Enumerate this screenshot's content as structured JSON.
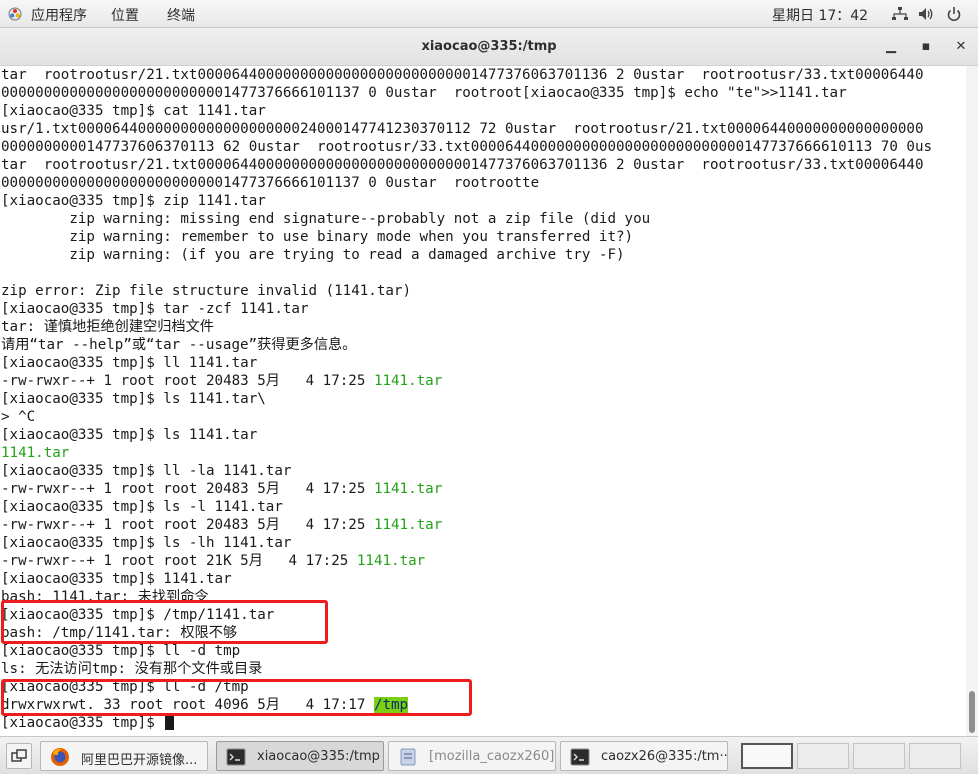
{
  "topbar": {
    "apps_label": "应用程序",
    "places_label": "位置",
    "terminal_label": "终端",
    "clock": "星期日 17：42"
  },
  "window": {
    "title": "xiaocao@335:/tmp",
    "minimize_label": "▁",
    "maximize_label": "▪",
    "close_label": "✕"
  },
  "terminal": {
    "lines": [
      {
        "text": "tar  rootrootusr/21.txt000064400000000000000000000000001477376063701136 2 0ustar  rootrootusr/33.txt00006440"
      },
      {
        "text": "000000000000000000000000001477376666101137 0 0ustar  rootroot[xiaocao@335 tmp]$ echo \"te\">>1141.tar"
      },
      {
        "text": "[xiaocao@335 tmp]$ cat 1141.tar"
      },
      {
        "text": "usr/1.txt0000644000000000000000000024000147741230370112 72 0ustar  rootrootusr/21.txt00006440000000000000000"
      },
      {
        "text": "0000000000147737606370113 62 0ustar  rootrootusr/33.txt00006440000000000000000000000000147737666610113 70 0us"
      },
      {
        "text": "tar  rootrootusr/21.txt000064400000000000000000000000001477376063701136 2 0ustar  rootrootusr/33.txt00006440"
      },
      {
        "text": "000000000000000000000000001477376666101137 0 0ustar  rootrootte"
      },
      {
        "text": "[xiaocao@335 tmp]$ zip 1141.tar"
      },
      {
        "text": "        zip warning: missing end signature--probably not a zip file (did you"
      },
      {
        "text": "        zip warning: remember to use binary mode when you transferred it?)"
      },
      {
        "text": "        zip warning: (if you are trying to read a damaged archive try -F)"
      },
      {
        "text": ""
      },
      {
        "text": "zip error: Zip file structure invalid (1141.tar)"
      },
      {
        "text": "[xiaocao@335 tmp]$ tar -zcf 1141.tar"
      },
      {
        "text": "tar: 谨慎地拒绝创建空归档文件"
      },
      {
        "text": "请用“tar --help”或“tar --usage”获得更多信息。"
      },
      {
        "text": "[xiaocao@335 tmp]$ ll 1141.tar"
      },
      {
        "text": "-rw-rwxr--+ 1 root root 20483 5月   4 17:25 ",
        "hl": "1141.tar"
      },
      {
        "text": "[xiaocao@335 tmp]$ ls 1141.tar\\"
      },
      {
        "text": "> ^C"
      },
      {
        "text": "[xiaocao@335 tmp]$ ls 1141.tar"
      },
      {
        "text": "",
        "hl": "1141.tar"
      },
      {
        "text": "[xiaocao@335 tmp]$ ll -la 1141.tar"
      },
      {
        "text": "-rw-rwxr--+ 1 root root 20483 5月   4 17:25 ",
        "hl": "1141.tar"
      },
      {
        "text": "[xiaocao@335 tmp]$ ls -l 1141.tar"
      },
      {
        "text": "-rw-rwxr--+ 1 root root 20483 5月   4 17:25 ",
        "hl": "1141.tar"
      },
      {
        "text": "[xiaocao@335 tmp]$ ls -lh 1141.tar"
      },
      {
        "text": "-rw-rwxr--+ 1 root root 21K 5月   4 17:25 ",
        "hl": "1141.tar"
      },
      {
        "text": "[xiaocao@335 tmp]$ 1141.tar"
      },
      {
        "text": "bash: 1141.tar: 未找到命令"
      },
      {
        "text": "[xiaocao@335 tmp]$ /tmp/1141.tar"
      },
      {
        "text": "bash: /tmp/1141.tar: 权限不够"
      },
      {
        "text": "[xiaocao@335 tmp]$ ll -d tmp"
      },
      {
        "text": "ls: 无法访问tmp: 没有那个文件或目录"
      },
      {
        "text": "[xiaocao@335 tmp]$ ll -d /tmp"
      },
      {
        "text": "drwxrwxrwt. 33 root root 4096 5月   4 17:17 ",
        "dir": "/tmp"
      },
      {
        "text": "[xiaocao@335 tmp]$ "
      }
    ]
  },
  "taskbar": {
    "items": [
      {
        "label": "阿里巴巴开源镜像..."
      },
      {
        "label": "xiaocao@335:/tmp"
      },
      {
        "label": "[mozilla_caozx260]"
      },
      {
        "label": "caozx26@335:/tm···"
      }
    ]
  },
  "colors": {
    "prompt_text": "#1a1a1a",
    "file_green": "#23a317",
    "dir_bg": "#7ad012",
    "annotation_red": "#ee1c1c"
  }
}
